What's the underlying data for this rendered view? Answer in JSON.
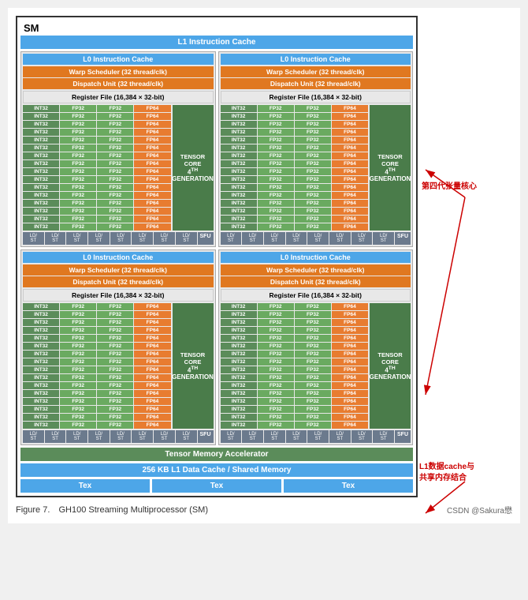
{
  "title": "SM",
  "l1_instruction_cache": "L1 Instruction Cache",
  "quadrants": [
    {
      "l0_cache": "L0 Instruction Cache",
      "warp_scheduler": "Warp Scheduler (32 thread/clk)",
      "dispatch_unit": "Dispatch Unit (32 thread/clk)",
      "register_file": "Register File (16,384 × 32-bit)",
      "tensor_core_line1": "TENSOR CORE",
      "tensor_core_gen": "4TH GENERATION"
    },
    {
      "l0_cache": "L0 Instruction Cache",
      "warp_scheduler": "Warp Scheduler (32 thread/clk)",
      "dispatch_unit": "Dispatch Unit (32 thread/clk)",
      "register_file": "Register File (16,384 × 32-bit)",
      "tensor_core_line1": "TENSOR CORE",
      "tensor_core_gen": "4TH GENERATION"
    },
    {
      "l0_cache": "L0 Instruction Cache",
      "warp_scheduler": "Warp Scheduler (32 thread/clk)",
      "dispatch_unit": "Dispatch Unit (32 thread/clk)",
      "register_file": "Register File (16,384 × 32-bit)",
      "tensor_core_line1": "TENSOR CORE",
      "tensor_core_gen": "4TH GENERATION"
    },
    {
      "l0_cache": "L0 Instruction Cache",
      "warp_scheduler": "Warp Scheduler (32 thread/clk)",
      "dispatch_unit": "Dispatch Unit (32 thread/clk)",
      "register_file": "Register File (16,384 × 32-bit)",
      "tensor_core_line1": "TENSOR CORE",
      "tensor_core_gen": "4TH GENERATION"
    }
  ],
  "tensor_memory_accelerator": "Tensor Memory Accelerator",
  "l1_data_cache": "256 KB L1 Data Cache / Shared Memory",
  "tex_label": "Tex",
  "figure_number": "Figure 7.",
  "figure_caption": "GH100 Streaming Multiprocessor (SM)",
  "csdn_author": "CSDN @Sakura懋",
  "annotation1": "第四代张量核心",
  "annotation2": "L1数据cache与\n共享内存结合",
  "sfu_label": "SFU",
  "ld_st_label": "LD/\nST"
}
